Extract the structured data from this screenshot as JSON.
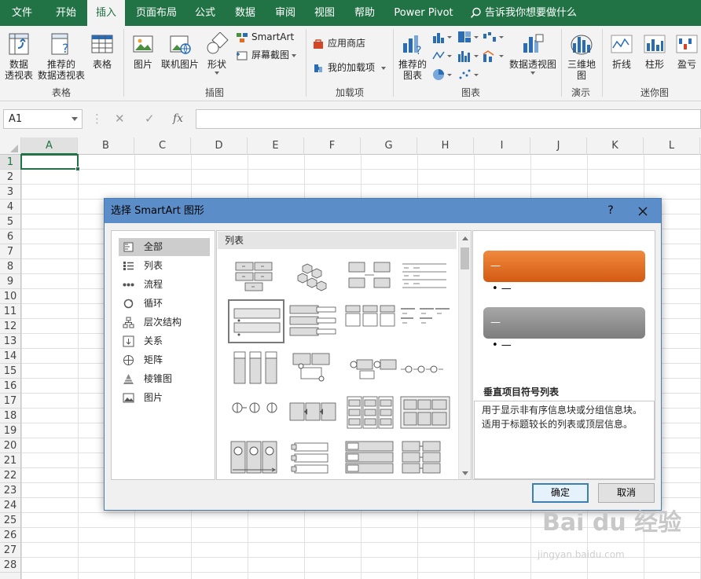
{
  "ribbon": {
    "tabs": [
      "文件",
      "开始",
      "插入",
      "页面布局",
      "公式",
      "数据",
      "审阅",
      "视图",
      "帮助",
      "Power Pivot"
    ],
    "active_tab": "插入",
    "tell_me": "告诉我你想要做什么",
    "groups": {
      "tables": {
        "name": "表格",
        "pivot": "数据\n透视表",
        "recommended_pivot": "推荐的\n数据透视表",
        "table": "表格"
      },
      "illustrations": {
        "name": "插图",
        "pictures": "图片",
        "online_pictures": "联机图片",
        "shapes": "形状",
        "smartart": "SmartArt",
        "screenshot": "屏幕截图"
      },
      "addins": {
        "name": "加载项",
        "store": "应用商店",
        "my_addins": "我的加载项"
      },
      "charts": {
        "name": "图表",
        "recommended": "推荐的\n图表",
        "pivot_chart": "数据透视图"
      },
      "tours": {
        "name": "演示",
        "map3d": "三维地\n图"
      },
      "sparklines": {
        "name": "迷你图",
        "line": "折线",
        "column": "柱形",
        "winloss": "盈亏"
      }
    }
  },
  "formula_bar": {
    "name_box": "A1",
    "fx": "fx",
    "formula": ""
  },
  "grid": {
    "columns": [
      "A",
      "B",
      "C",
      "D",
      "E",
      "F",
      "G",
      "H",
      "I",
      "J",
      "K",
      "L"
    ],
    "rows": [
      "1",
      "2",
      "3",
      "4",
      "5",
      "6",
      "7",
      "8",
      "9",
      "10",
      "11",
      "12",
      "13",
      "14",
      "15",
      "16",
      "17",
      "18",
      "19",
      "20",
      "21",
      "22",
      "23",
      "24",
      "25",
      "26",
      "27",
      "28"
    ],
    "active_cell": "A1"
  },
  "dialog": {
    "title": "选择 SmartArt 图形",
    "help": "?",
    "categories": [
      "全部",
      "列表",
      "流程",
      "循环",
      "层次结构",
      "关系",
      "矩阵",
      "棱锥图",
      "图片"
    ],
    "selected_category": "全部",
    "gallery_header": "列表",
    "preview": {
      "bar1_text": "—",
      "bullet1": "• —",
      "bar2_text": "—",
      "bullet2": "• —",
      "title": "垂直项目符号列表",
      "description": "用于显示非有序信息块或分组信息块。适用于标题较长的列表或顶层信息。",
      "colors": {
        "orange": "#e46c22",
        "gray": "#8c8c8c"
      }
    },
    "ok": "确定",
    "cancel": "取消"
  },
  "watermark": {
    "main": "Bai du 经验",
    "sub": "jingyan.baidu.com"
  }
}
